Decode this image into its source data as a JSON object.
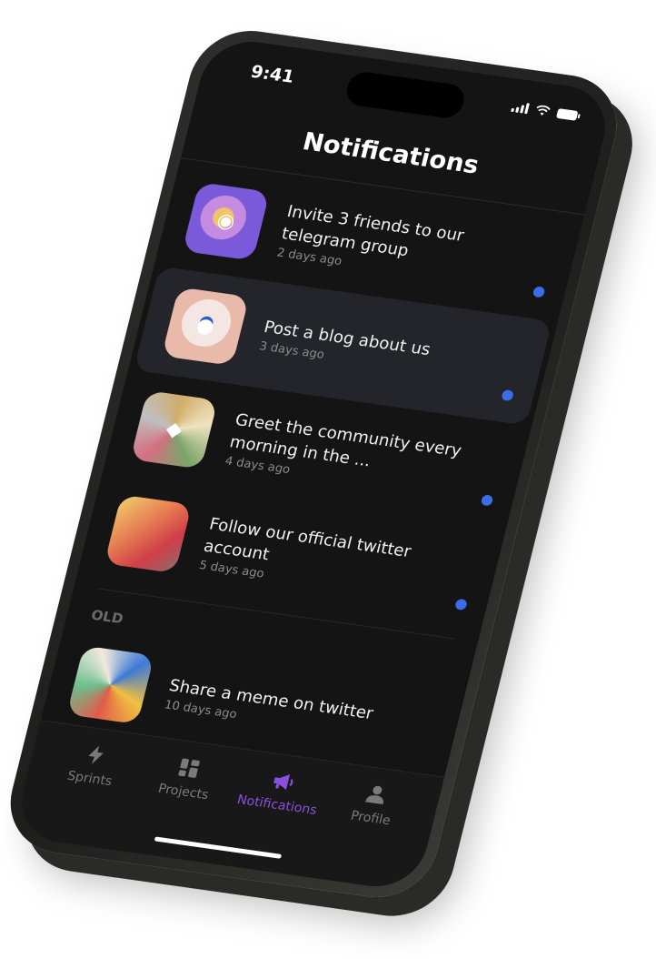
{
  "status_bar": {
    "time": "9:41"
  },
  "header": {
    "title": "Notifications"
  },
  "notifications": [
    {
      "title": "Invite 3 friends to our telegram group",
      "time": "2 days ago",
      "thumbnail": "coins-artwork",
      "unread": true
    },
    {
      "title": "Post a blog about us",
      "time": "3 days ago",
      "thumbnail": "network-artwork",
      "unread": true,
      "highlighted": true
    },
    {
      "title": "Greet the community every morning in the ...",
      "time": "4 days ago",
      "thumbnail": "ethereum-artwork",
      "unread": true
    },
    {
      "title": "Follow our official twitter account",
      "time": "5 days ago",
      "thumbnail": "abstract-paint-artwork",
      "unread": true
    }
  ],
  "old_section": {
    "label": "OLD",
    "items": [
      {
        "title": "Share a meme on twitter",
        "time": "10 days ago",
        "thumbnail": "colorful-paint-artwork",
        "unread": false
      }
    ]
  },
  "tab_bar": {
    "tabs": [
      {
        "label": "Sprints",
        "icon": "lightning-icon",
        "active": false
      },
      {
        "label": "Projects",
        "icon": "grid-icon",
        "active": false
      },
      {
        "label": "Notifications",
        "icon": "megaphone-icon",
        "active": true
      },
      {
        "label": "Profile",
        "icon": "person-icon",
        "active": false
      }
    ]
  },
  "colors": {
    "background": "#141414",
    "accent": "#8a4fe0",
    "unread_dot": "#3b6de8",
    "highlight_row": "#23252b",
    "muted_text": "#8b8b8b"
  }
}
